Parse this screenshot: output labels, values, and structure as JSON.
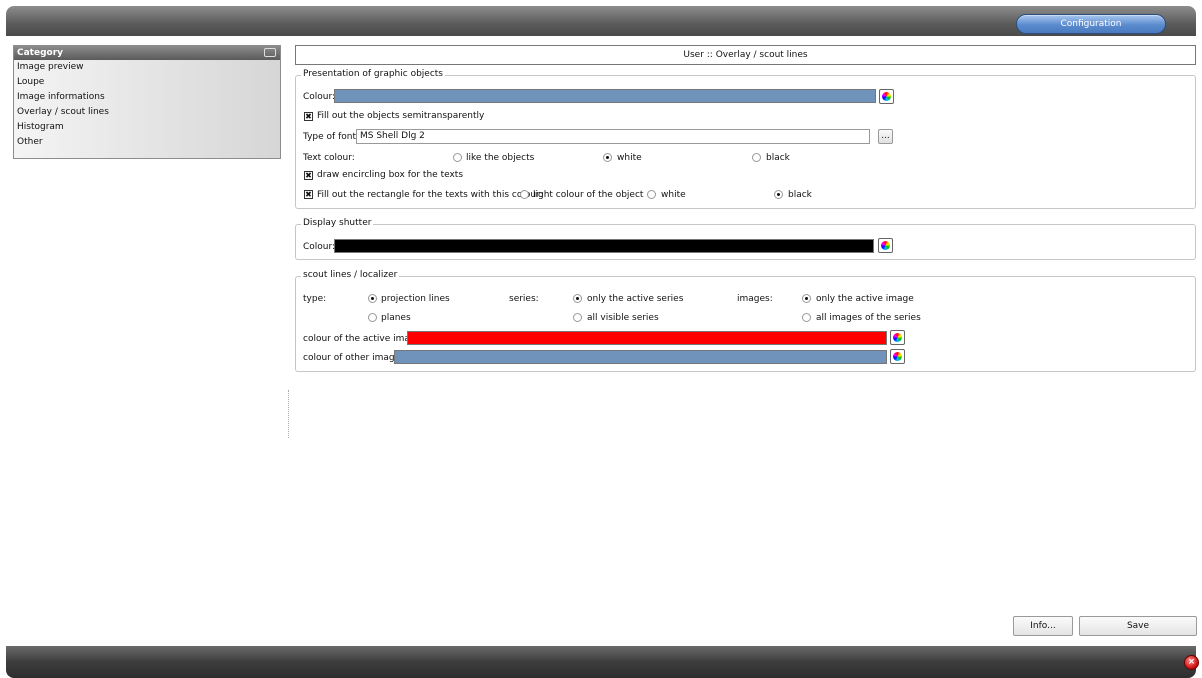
{
  "toolbar": {
    "config_label": "Configuration"
  },
  "category": {
    "header": "Category",
    "items": [
      "Image preview",
      "Loupe",
      "Image informations",
      "Overlay / scout lines",
      "Histogram",
      "Other"
    ]
  },
  "page": {
    "title": "User :: Overlay / scout lines"
  },
  "presentation": {
    "legend": "Presentation of graphic objects",
    "colour_label": "Colour:",
    "colour": "#6f93bb",
    "fill_semi_label": "Fill out the objects semitransparently",
    "fill_semi_checked": true,
    "font_label": "Type of font:",
    "font_value": "MS Shell Dlg 2",
    "font_button": "...",
    "text_colour_label": "Text colour:",
    "text_colour_options": [
      "like the objects",
      "white",
      "black"
    ],
    "text_colour_selected": "white",
    "encircling_label": "draw encircling box for the texts",
    "encircling_checked": true,
    "fill_rect_label": "Fill out the rectangle for the texts with this colour:",
    "fill_rect_checked": true,
    "fill_rect_options": [
      "light colour of the object",
      "white",
      "black"
    ],
    "fill_rect_selected": "black"
  },
  "shutter": {
    "legend": "Display shutter",
    "colour_label": "Colour:",
    "colour": "#000000"
  },
  "scout": {
    "legend": "scout lines / localizer",
    "type_label": "type:",
    "type_options": [
      "projection lines",
      "planes"
    ],
    "type_selected": "projection lines",
    "series_label": "series:",
    "series_options": [
      "only the active series",
      "all visible series"
    ],
    "series_selected": "only the active series",
    "images_label": "images:",
    "images_options": [
      "only the active image",
      "all images of the series"
    ],
    "images_selected": "only the active image",
    "active_colour_label": "colour of the active image:",
    "active_colour": "#ff0000",
    "other_colour_label": "colour of other images:",
    "other_colour": "#6f93bb"
  },
  "footer": {
    "info_label": "Info...",
    "save_label": "Save",
    "close_glyph": "×"
  }
}
